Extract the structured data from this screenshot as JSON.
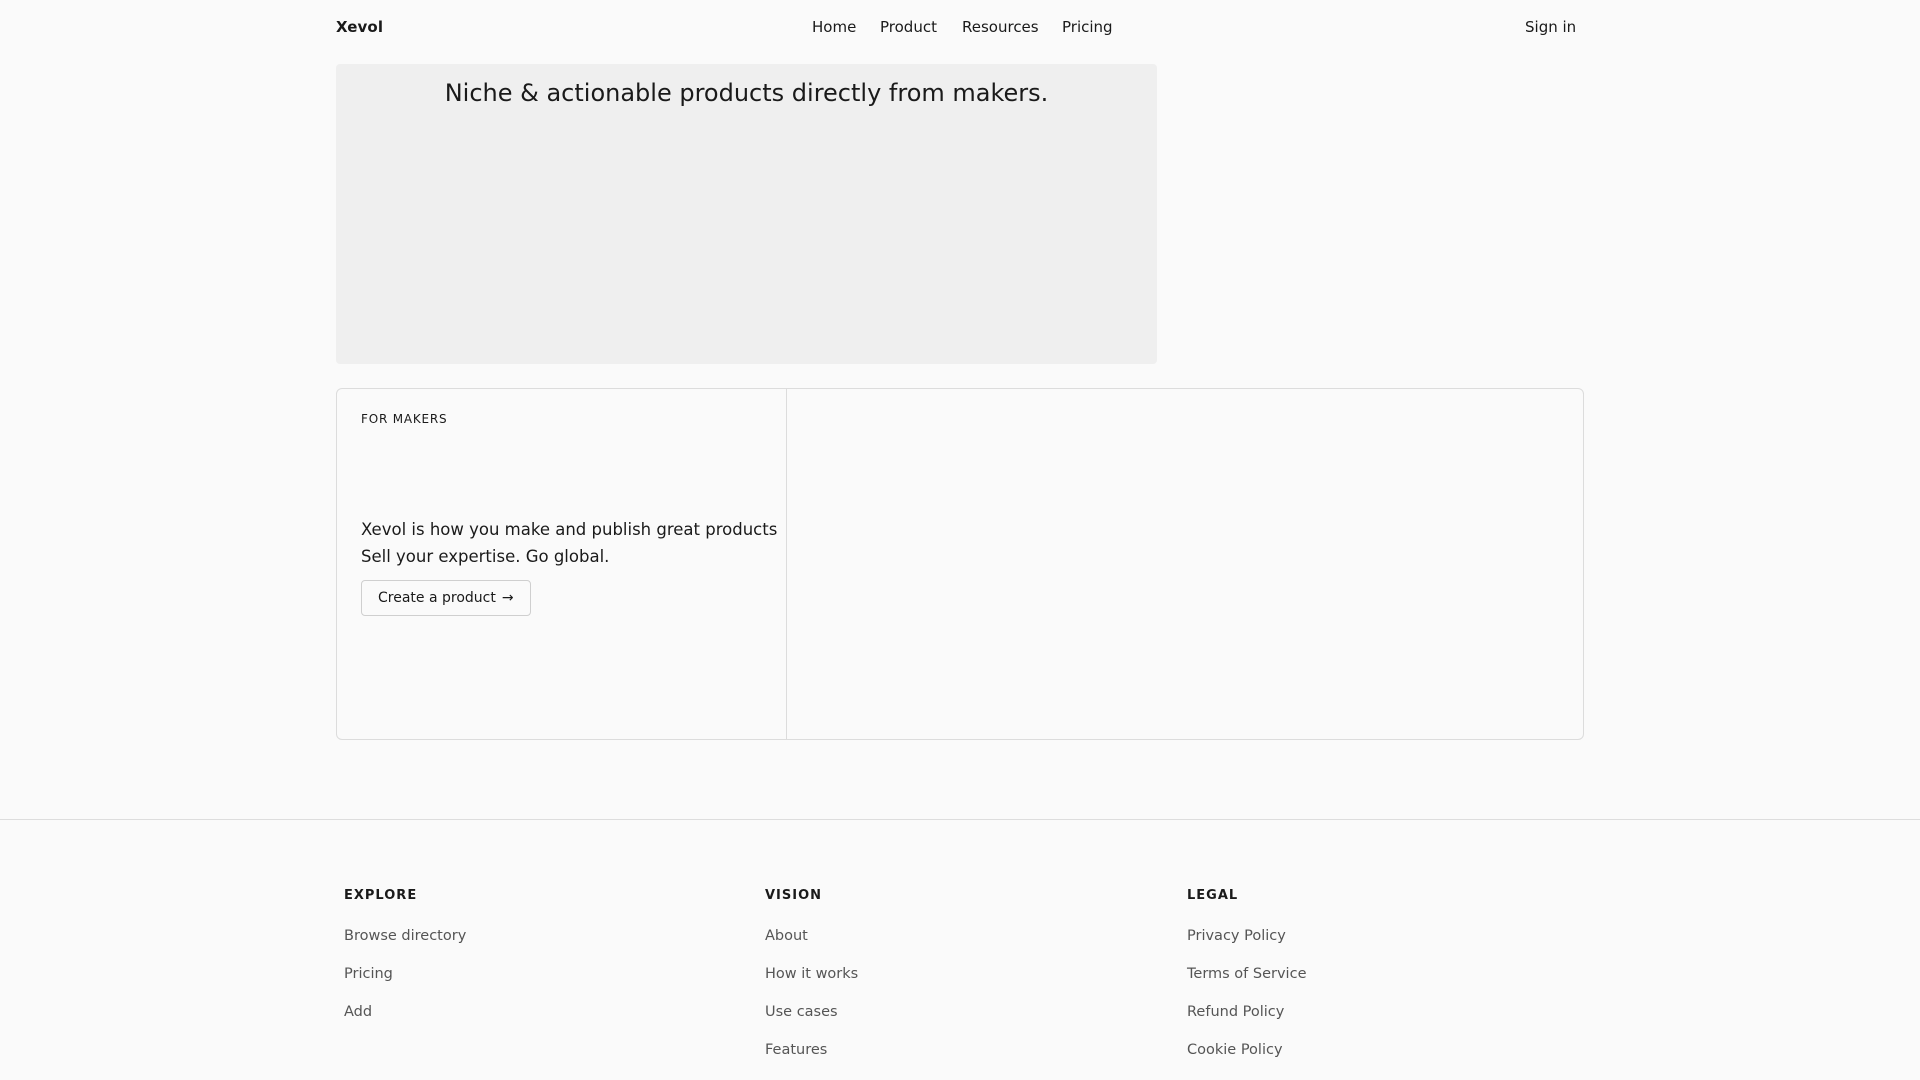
{
  "header": {
    "logo": "Xevol",
    "nav": [
      {
        "label": "Home"
      },
      {
        "label": "Product"
      },
      {
        "label": "Resources"
      },
      {
        "label": "Pricing"
      }
    ],
    "signin": "Sign in"
  },
  "hero": {
    "title": "Niche & actionable products directly from makers."
  },
  "makers": {
    "eyebrow": "FOR MAKERS",
    "line1": "Xevol is how you make and publish great products",
    "line2": "Sell your expertise. Go global.",
    "cta_label": "Create a product",
    "cta_arrow": "→"
  },
  "footer": {
    "columns": [
      {
        "heading": "EXPLORE",
        "links": [
          "Browse directory",
          "Pricing",
          "Add"
        ]
      },
      {
        "heading": "VISION",
        "links": [
          "About",
          "How it works",
          "Use cases",
          "Features"
        ]
      },
      {
        "heading": "LEGAL",
        "links": [
          "Privacy Policy",
          "Terms of Service",
          "Refund Policy",
          "Cookie Policy"
        ]
      }
    ]
  }
}
